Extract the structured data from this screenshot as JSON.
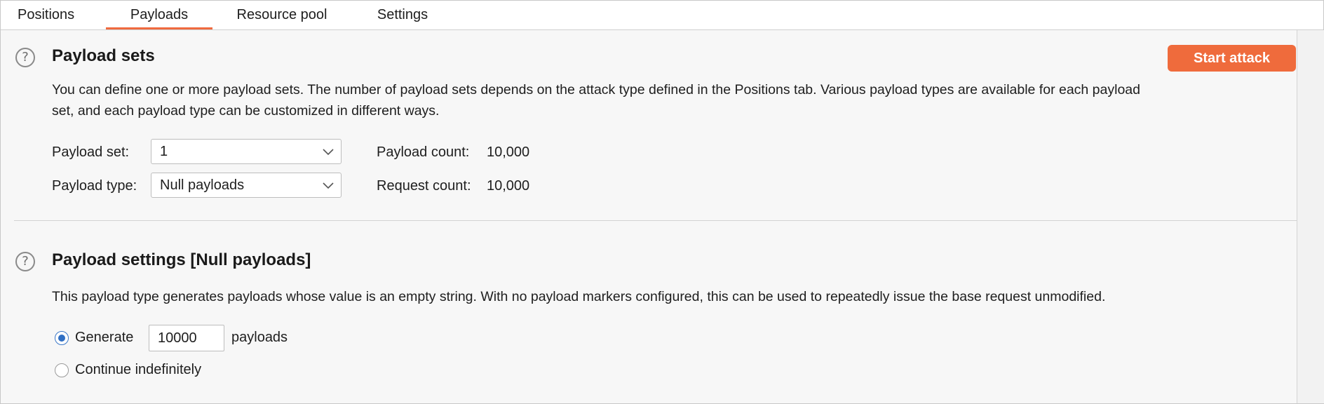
{
  "tabs": [
    {
      "label": "Positions"
    },
    {
      "label": "Payloads",
      "active": true
    },
    {
      "label": "Resource pool"
    },
    {
      "label": "Settings"
    }
  ],
  "payload_sets": {
    "title": "Payload sets",
    "description_line1": "You can define one or more payload sets. The number of payload sets depends on the attack type defined in the Positions tab. Various payload types are available for each payload",
    "description_line2": "set, and each payload type can be customized in different ways.",
    "set_label": "Payload set:",
    "set_value": "1",
    "type_label": "Payload type:",
    "type_value": "Null payloads",
    "payload_count_label": "Payload count:",
    "payload_count_value": "10,000",
    "request_count_label": "Request count:",
    "request_count_value": "10,000",
    "start_button": "Start attack"
  },
  "payload_settings": {
    "title": "Payload settings [Null payloads]",
    "description": "This payload type generates payloads whose value is an empty string. With no payload markers configured, this can be used to repeatedly issue the base request unmodified.",
    "generate_label": "Generate",
    "generate_value": "10000",
    "payloads_suffix": "payloads",
    "continue_label": "Continue indefinitely",
    "selected_option": "Generate"
  },
  "colors": {
    "accent": "#ef6b3c",
    "radio_selected": "#2f6fc4"
  },
  "icons": [
    "help-icon",
    "chevron-down-icon"
  ]
}
